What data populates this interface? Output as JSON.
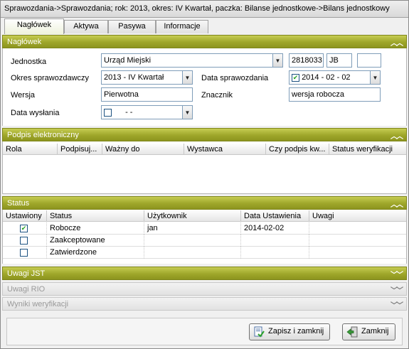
{
  "window": {
    "title": "Sprawozdania->Sprawozdania; rok: 2013, okres: IV Kwartał, paczka: Bilanse jednostkowe->Bilans jednostkowy"
  },
  "tabs": [
    {
      "label": "Nagłówek",
      "active": true
    },
    {
      "label": "Aktywa",
      "active": false
    },
    {
      "label": "Pasywa",
      "active": false
    },
    {
      "label": "Informacje",
      "active": false
    }
  ],
  "naglowek": {
    "header": "Nagłówek",
    "jednostka_label": "Jednostka",
    "jednostka_value": "Urząd Miejski",
    "code_value": "2818033",
    "type_value": "JB",
    "extra_value": "",
    "okres_label": "Okres sprawozdawczy",
    "okres_value": "2013 - IV Kwartał",
    "data_spr_label": "Data sprawozdania",
    "data_spr_value": "2014 - 02 - 02",
    "data_spr_checked": true,
    "wersja_label": "Wersja",
    "wersja_value": "Pierwotna",
    "znacznik_label": "Znacznik",
    "znacznik_value": "wersja robocza",
    "data_wys_label": "Data wysłania",
    "data_wys_value": "  -     -",
    "data_wys_checked": false
  },
  "podpis": {
    "header": "Podpis elektroniczny",
    "columns": [
      "Rola",
      "Podpisuj...",
      "Ważny do",
      "Wystawca",
      "Czy podpis kw...",
      "Status weryfikacji"
    ]
  },
  "status": {
    "header": "Status",
    "columns": [
      "Ustawiony",
      "Status",
      "Użytkownik",
      "Data Ustawienia",
      "Uwagi"
    ],
    "rows": [
      {
        "checked": true,
        "status": "Robocze",
        "user": "jan",
        "date": "2014-02-02",
        "notes": ""
      },
      {
        "checked": false,
        "status": "Zaakceptowane",
        "user": "",
        "date": "",
        "notes": ""
      },
      {
        "checked": false,
        "status": "Zatwierdzone",
        "user": "",
        "date": "",
        "notes": ""
      }
    ]
  },
  "sections": {
    "uwagi_jst": "Uwagi JST",
    "uwagi_rio": "Uwagi RIO",
    "wyniki": "Wyniki weryfikacji"
  },
  "buttons": {
    "save_close": "Zapisz i zamknij",
    "close": "Zamknij"
  },
  "icons": {
    "collapse": "double-chevron-up-icon",
    "expand": "double-chevron-down-icon",
    "dropdown": "triangle-down-icon",
    "save": "save-document-icon",
    "exit": "exit-door-icon"
  },
  "colors": {
    "header_accent": "#9ea62a",
    "field_border": "#7f9db9"
  }
}
